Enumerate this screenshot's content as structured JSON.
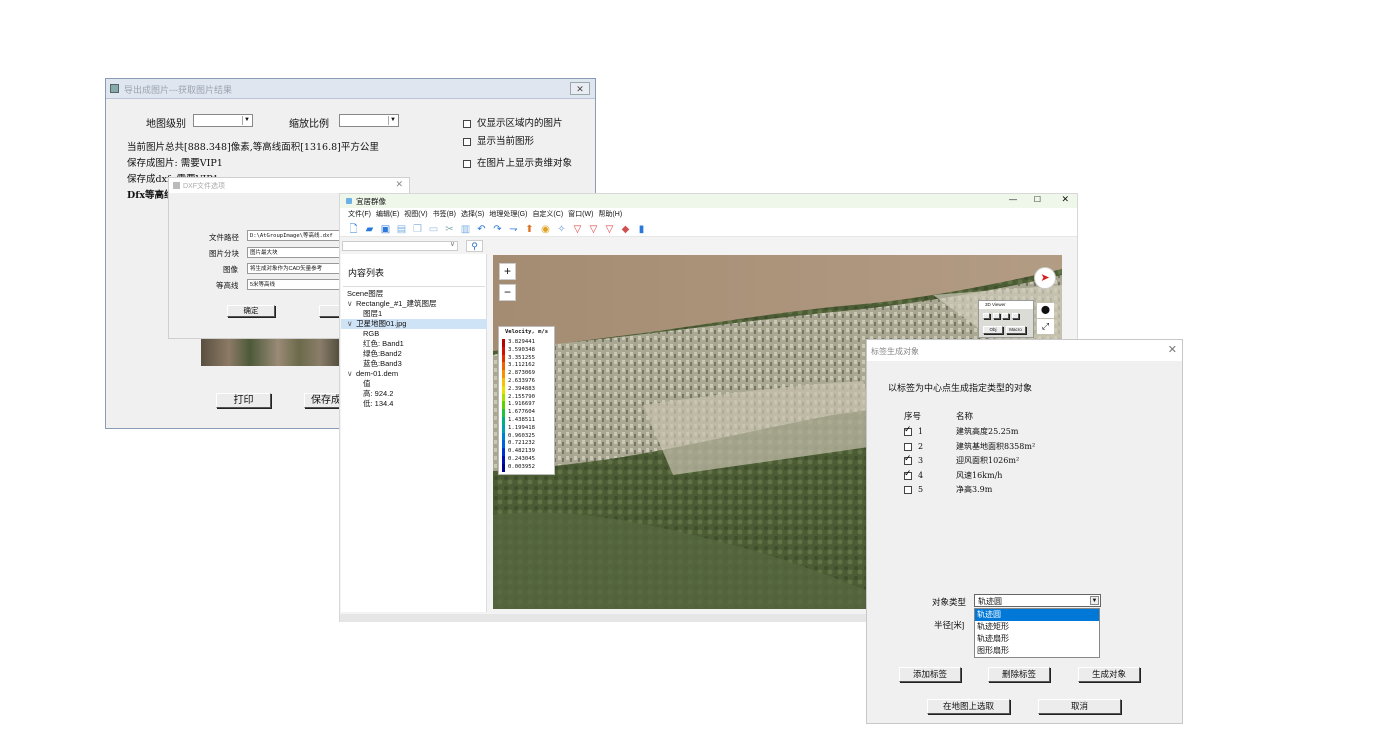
{
  "export_dialog": {
    "title": "导出成图片---获取图片结果",
    "map_level_label": "地图级别",
    "scale_label": "缩放比例",
    "cb_region_only": "仅显示区域内的图片",
    "cb_show_shapes": "显示当前图形",
    "cb_show_3d": "在图片上显示贵维对象",
    "info_line1": "当前图片总共[888.348]像素,等高线面积[1316.8]平方公里",
    "info_line2": "保存成图片: 需要VIP1",
    "info_line3": "保存成dxf: 需要VIP1",
    "info_line4": "Dfx等高线",
    "print_button": "打印",
    "save_button": "保存成"
  },
  "dxf_dialog": {
    "title": "DXF文件选项",
    "path_label": "文件路径",
    "path_value": "D:\\AtGroupImage\\等高线.dxf",
    "tile_label": "图片分块",
    "tile_value": "图片最大块",
    "image_label": "图像",
    "image_value": "将生成对象作为CAD矢量参考",
    "contour_label": "等高线",
    "contour_value": "5米等高线",
    "ok_button": "确定",
    "cancel_button": "取"
  },
  "main_window": {
    "title": "宜居群像",
    "menu": [
      "文件(F)",
      "编辑(E)",
      "视图(V)",
      "书签(B)",
      "选择(S)",
      "地理处理(G)",
      "自定义(C)",
      "窗口(W)",
      "帮助(H)"
    ],
    "toolbar_icons": [
      "new-file-icon",
      "open-folder-icon",
      "save-icon",
      "print-icon",
      "copy-icon",
      "paste-icon",
      "cut-icon",
      "delete-icon",
      "undo-icon",
      "redo-icon",
      "arrow-icon",
      "pin-up-icon",
      "marker-icon",
      "star-icon",
      "filter-icon",
      "filter2-icon",
      "filter3-icon",
      "paint-icon",
      "bookmark-icon"
    ],
    "panel_title": "内容列表",
    "tree": [
      {
        "text": "Scene图层",
        "indent": 0,
        "toggle": ""
      },
      {
        "text": "Rectangle_#1_建筑图层",
        "indent": 0,
        "toggle": "∨"
      },
      {
        "text": "图层1",
        "indent": 2,
        "toggle": ""
      },
      {
        "text": "卫星地图01.jpg",
        "indent": 0,
        "toggle": "∨",
        "selected": true
      },
      {
        "text": "RGB",
        "indent": 2,
        "toggle": ""
      },
      {
        "text": "红色: Band1",
        "indent": 2,
        "toggle": ""
      },
      {
        "text": "绿色:Band2",
        "indent": 2,
        "toggle": ""
      },
      {
        "text": "蓝色:Band3",
        "indent": 2,
        "toggle": ""
      },
      {
        "text": "dem-01.dem",
        "indent": 0,
        "toggle": "∨"
      },
      {
        "text": "值",
        "indent": 2,
        "toggle": ""
      },
      {
        "text": "高: 924.2",
        "indent": 2,
        "toggle": ""
      },
      {
        "text": "低: 134.4",
        "indent": 2,
        "toggle": ""
      }
    ],
    "legend_title": "Velocity, m/s",
    "legend_values": [
      "3.829441",
      "3.590348",
      "3.351255",
      "3.112162",
      "2.873069",
      "2.633976",
      "2.394883",
      "2.155790",
      "1.916697",
      "1.677604",
      "1.438511",
      "1.199418",
      "0.960325",
      "0.721232",
      "0.482139",
      "0.243045",
      "0.003952"
    ],
    "legend_colors": [
      "#b80000",
      "#d01000",
      "#e03000",
      "#f06000",
      "#f89000",
      "#f8c000",
      "#e8e000",
      "#a8e000",
      "#60d000",
      "#20c040",
      "#00b080",
      "#00a0b0",
      "#0080d0",
      "#0060e0",
      "#0030d0",
      "#0010b0",
      "#000090"
    ],
    "zoom_in": "+",
    "zoom_out": "−",
    "mini_viewer_title": "3D Viewer",
    "mini_btn1": "Obj",
    "mini_btn2": "Macro"
  },
  "label_dialog": {
    "title": "标签生成对象",
    "description": "以标签为中心点生成指定类型的对象",
    "col_index": "序号",
    "col_name": "名称",
    "rows": [
      {
        "checked": true,
        "index": "1",
        "name": "建筑高度25.25m"
      },
      {
        "checked": false,
        "index": "2",
        "name": "建筑基地面积8358m²"
      },
      {
        "checked": true,
        "index": "3",
        "name": "迎风面积1026m²"
      },
      {
        "checked": true,
        "index": "4",
        "name": "风速16km/h"
      },
      {
        "checked": false,
        "index": "5",
        "name": "净高3.9m"
      }
    ],
    "type_label": "对象类型",
    "type_selected": "轨迹圆",
    "type_options": [
      "轨迹圆",
      "轨迹矩形",
      "轨迹扇形",
      "图形扇形"
    ],
    "radius_label": "半径[米]",
    "add_label_button": "添加标签",
    "delete_label_button": "删除标签",
    "generate_button": "生成对象",
    "pick_on_map_button": "在地图上选取",
    "cancel_button": "取消"
  }
}
